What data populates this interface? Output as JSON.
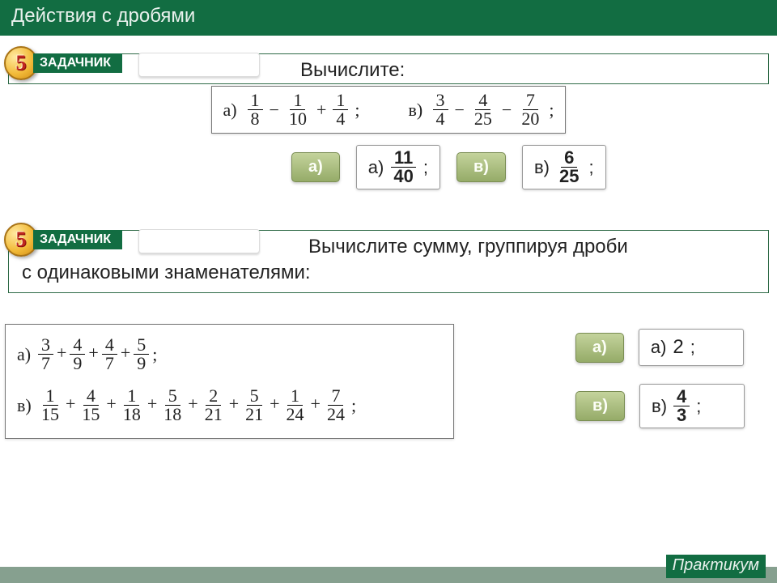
{
  "header": {
    "title": "Действия с дробями"
  },
  "footer": {
    "label": "Практикум"
  },
  "badge": {
    "number": "5",
    "label": "ЗАДАЧНИК"
  },
  "task1": {
    "prompt": "Вычислите:",
    "problems": {
      "a": {
        "label": "а)",
        "f1": {
          "n": "1",
          "d": "8"
        },
        "op1": "−",
        "f2": {
          "n": "1",
          "d": "10"
        },
        "op2": "+",
        "f3": {
          "n": "1",
          "d": "4"
        }
      },
      "v": {
        "label": "в)",
        "f1": {
          "n": "3",
          "d": "4"
        },
        "op1": "−",
        "f2": {
          "n": "4",
          "d": "25"
        },
        "op2": "−",
        "f3": {
          "n": "7",
          "d": "20"
        }
      }
    },
    "chips": {
      "a": "а)",
      "v": "в)"
    },
    "answers": {
      "a": {
        "label": "а)",
        "num": "11",
        "den": "40",
        "tail": ";"
      },
      "v": {
        "label": "в)",
        "num": "6",
        "den": "25",
        "tail": ";"
      }
    }
  },
  "task2": {
    "prompt_line1": "Вычислите сумму, группируя дроби",
    "prompt_line2": "с одинаковыми знаменателями:",
    "problems": {
      "a": {
        "label": "а)",
        "terms": [
          {
            "n": "3",
            "d": "7"
          },
          {
            "op": "+"
          },
          {
            "n": "4",
            "d": "9"
          },
          {
            "op": "+"
          },
          {
            "n": "4",
            "d": "7"
          },
          {
            "op": "+"
          },
          {
            "n": "5",
            "d": "9"
          }
        ]
      },
      "v": {
        "label": "в)",
        "terms": [
          {
            "n": "1",
            "d": "15"
          },
          {
            "op": "+"
          },
          {
            "n": "4",
            "d": "15"
          },
          {
            "op": "+"
          },
          {
            "n": "1",
            "d": "18"
          },
          {
            "op": "+"
          },
          {
            "n": "5",
            "d": "18"
          },
          {
            "op": "+"
          },
          {
            "n": "2",
            "d": "21"
          },
          {
            "op": "+"
          },
          {
            "n": "5",
            "d": "21"
          },
          {
            "op": "+"
          },
          {
            "n": "1",
            "d": "24"
          },
          {
            "op": "+"
          },
          {
            "n": "7",
            "d": "24"
          }
        ]
      }
    },
    "chips": {
      "a": "а)",
      "v": "в)"
    },
    "answers": {
      "a": {
        "label": "а)",
        "whole": "2",
        "tail": ";"
      },
      "v": {
        "label": "в)",
        "num": "4",
        "den": "3",
        "tail": ";"
      }
    }
  }
}
